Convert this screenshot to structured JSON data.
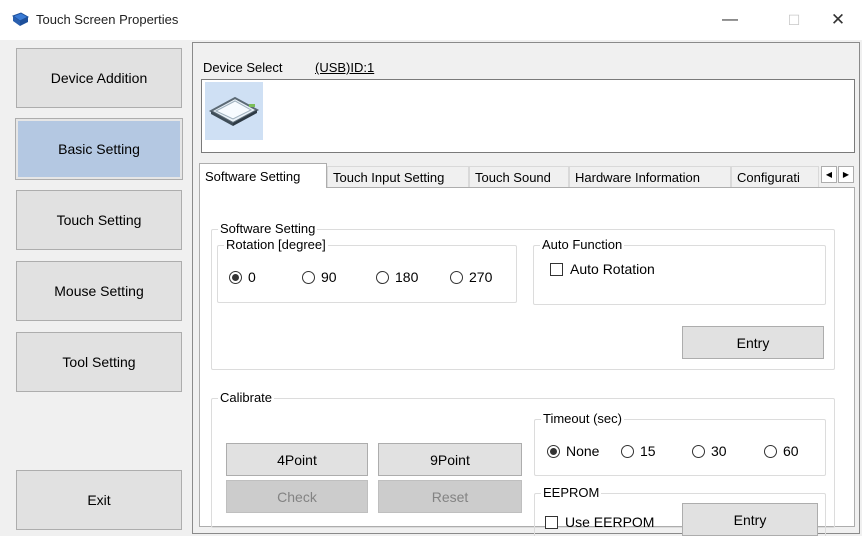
{
  "window": {
    "title": "Touch Screen Properties",
    "minimize_glyph": "—",
    "maximize_glyph": "☐",
    "close_glyph": "✕"
  },
  "nav": {
    "items": [
      {
        "label": "Device Addition"
      },
      {
        "label": "Basic Setting",
        "active": true
      },
      {
        "label": "Touch Setting"
      },
      {
        "label": "Mouse Setting"
      },
      {
        "label": "Tool Setting"
      }
    ],
    "exit_label": "Exit"
  },
  "device": {
    "select_label": "Device Select",
    "id_label": "(USB)ID:1",
    "icon": "touchscreen-device-icon"
  },
  "tabs": {
    "items": [
      {
        "label": "Software Setting",
        "selected": true
      },
      {
        "label": "Touch Input Setting"
      },
      {
        "label": "Touch Sound"
      },
      {
        "label": "Hardware Information"
      },
      {
        "label": "Configurati"
      }
    ],
    "scroll_left": "◀",
    "scroll_right": "▶"
  },
  "software_setting": {
    "group_title": "Software Setting",
    "rotation": {
      "title": "Rotation [degree]",
      "options": [
        "0",
        "90",
        "180",
        "270"
      ],
      "selected": "0"
    },
    "auto_function": {
      "title": "Auto Function",
      "auto_rotation_label": "Auto Rotation",
      "auto_rotation_checked": false
    },
    "entry_label": "Entry"
  },
  "calibrate": {
    "group_title": "Calibrate",
    "point4_label": "4Point",
    "point9_label": "9Point",
    "check_label": "Check",
    "reset_label": "Reset",
    "timeout": {
      "title": "Timeout (sec)",
      "options": [
        "None",
        "15",
        "30",
        "60"
      ],
      "selected": "None"
    },
    "eeprom": {
      "title": "EEPROM",
      "use_label": "Use EERPOM",
      "checked": false,
      "entry_label": "Entry"
    }
  },
  "colors": {
    "window_bg": "#f0f0f0",
    "button_bg": "#e1e1e1",
    "active_nav_bg": "#b4c8e2",
    "disabled_button_bg": "#cccccc",
    "disabled_text": "#838383"
  }
}
